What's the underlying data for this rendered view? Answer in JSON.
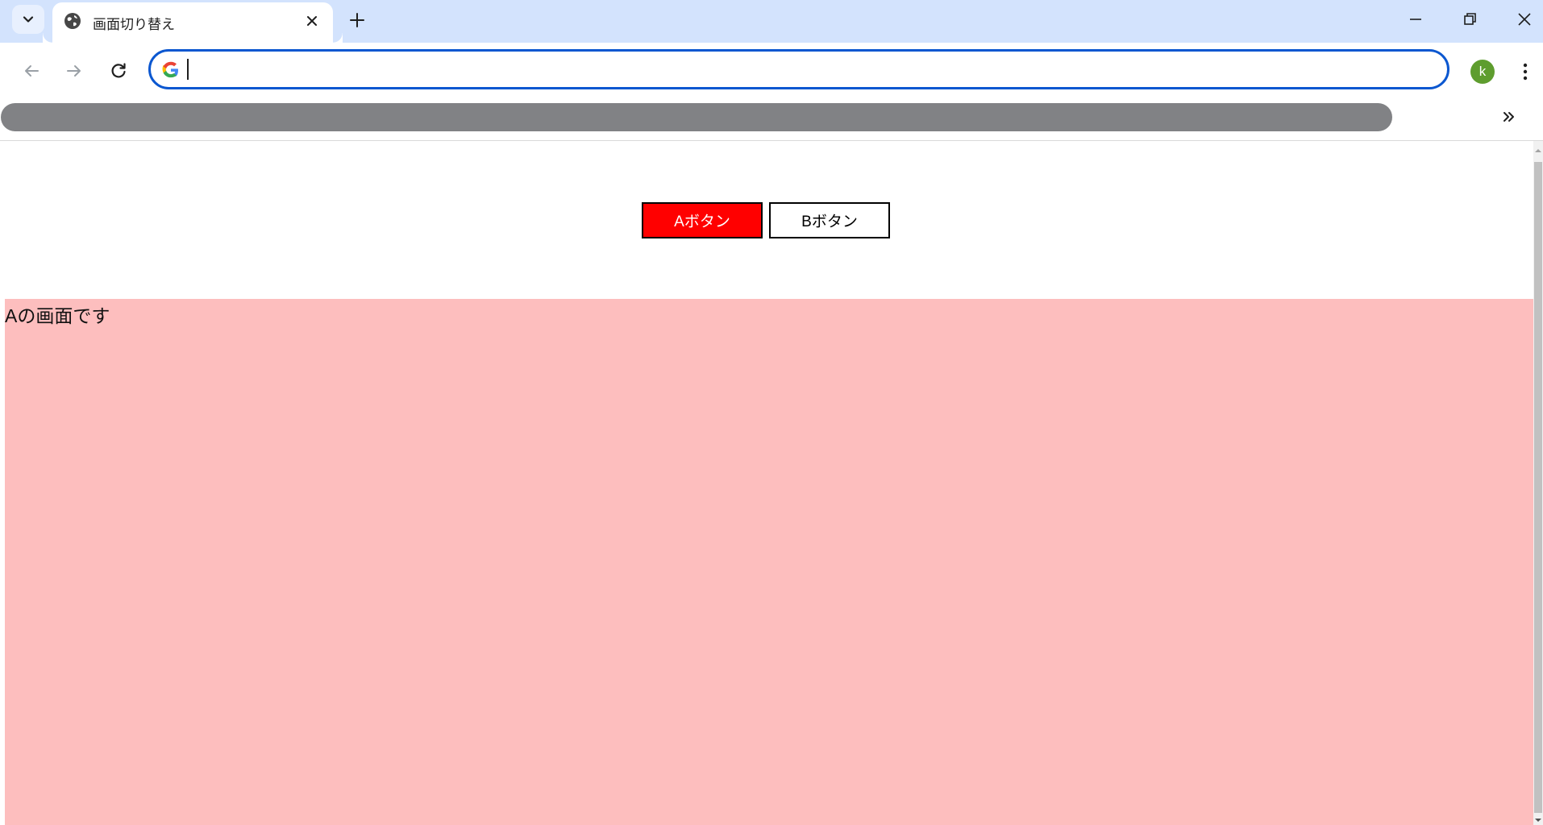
{
  "browser": {
    "tab": {
      "title": "画面切り替え"
    },
    "omnibox": {
      "value": "",
      "placeholder": ""
    },
    "profile": {
      "initial": "k",
      "color": "#5e9d2e"
    },
    "accent_color": "#0b57d0"
  },
  "page": {
    "buttons": [
      {
        "label": "Aボタン",
        "state": "active",
        "background": "#ff0000",
        "text_color": "#ffffff"
      },
      {
        "label": "Bボタン",
        "state": "inactive",
        "background": "#ffffff",
        "text_color": "#000000"
      }
    ],
    "panel": {
      "text": "Aの画面です",
      "background": "#fdbebe"
    }
  }
}
